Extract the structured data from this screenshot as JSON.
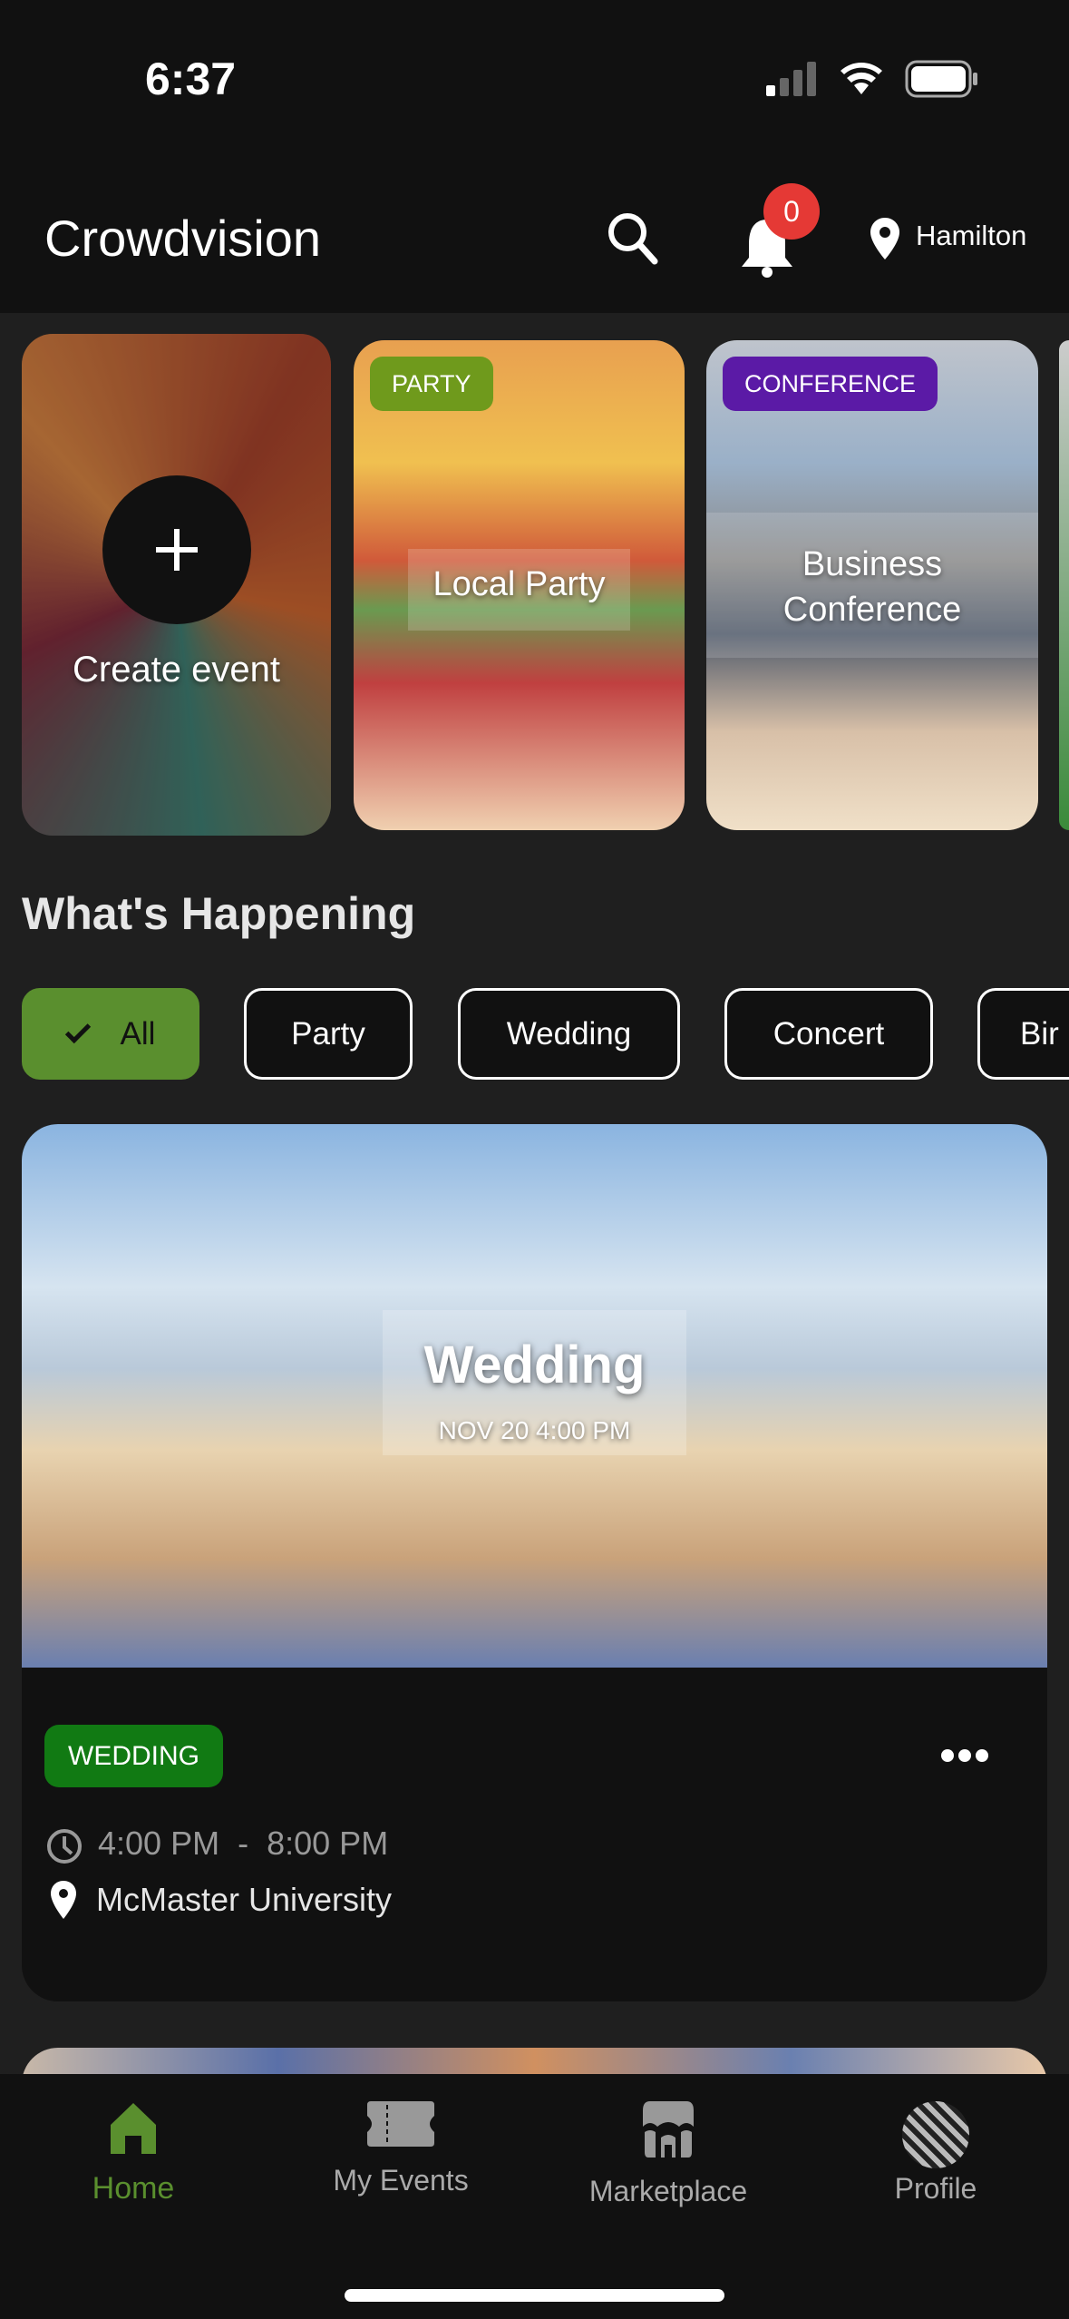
{
  "status_bar": {
    "time": "6:37"
  },
  "header": {
    "title": "Crowdvision",
    "notification_count": "0",
    "location": "Hamilton"
  },
  "featured": [
    {
      "label": "Create event"
    },
    {
      "tag": "PARTY",
      "tag_color": "#6f9a1c",
      "title": "Local Party"
    },
    {
      "tag": "CONFERENCE",
      "tag_color": "#5b1aa6",
      "title": "Business Conference"
    }
  ],
  "section_title": "What's Happening",
  "filters": [
    {
      "label": "All",
      "selected": true
    },
    {
      "label": "Party"
    },
    {
      "label": "Wedding"
    },
    {
      "label": "Concert"
    },
    {
      "label": "Bir"
    }
  ],
  "event": {
    "title": "Wedding",
    "date": "NOV 20 4:00 PM",
    "tag": "WEDDING",
    "tag_color": "#117a13",
    "time_start": "4:00 PM",
    "time_sep": "-",
    "time_end": "8:00 PM",
    "location": "McMaster University"
  },
  "nav": [
    {
      "label": "Home",
      "active": true
    },
    {
      "label": "My Events"
    },
    {
      "label": "Marketplace"
    },
    {
      "label": "Profile"
    }
  ],
  "colors": {
    "accent": "#5a8f2e",
    "background": "#1f1f1f"
  }
}
